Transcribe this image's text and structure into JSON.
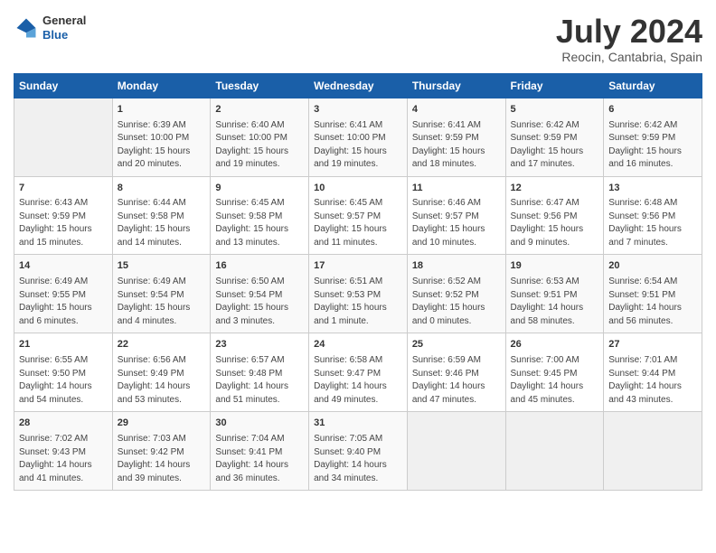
{
  "header": {
    "logo_general": "General",
    "logo_blue": "Blue",
    "month_title": "July 2024",
    "location": "Reocin, Cantabria, Spain"
  },
  "weekdays": [
    "Sunday",
    "Monday",
    "Tuesday",
    "Wednesday",
    "Thursday",
    "Friday",
    "Saturday"
  ],
  "weeks": [
    [
      {
        "day": "",
        "content": ""
      },
      {
        "day": "1",
        "content": "Sunrise: 6:39 AM\nSunset: 10:00 PM\nDaylight: 15 hours\nand 20 minutes."
      },
      {
        "day": "2",
        "content": "Sunrise: 6:40 AM\nSunset: 10:00 PM\nDaylight: 15 hours\nand 19 minutes."
      },
      {
        "day": "3",
        "content": "Sunrise: 6:41 AM\nSunset: 10:00 PM\nDaylight: 15 hours\nand 19 minutes."
      },
      {
        "day": "4",
        "content": "Sunrise: 6:41 AM\nSunset: 9:59 PM\nDaylight: 15 hours\nand 18 minutes."
      },
      {
        "day": "5",
        "content": "Sunrise: 6:42 AM\nSunset: 9:59 PM\nDaylight: 15 hours\nand 17 minutes."
      },
      {
        "day": "6",
        "content": "Sunrise: 6:42 AM\nSunset: 9:59 PM\nDaylight: 15 hours\nand 16 minutes."
      }
    ],
    [
      {
        "day": "7",
        "content": "Sunrise: 6:43 AM\nSunset: 9:59 PM\nDaylight: 15 hours\nand 15 minutes."
      },
      {
        "day": "8",
        "content": "Sunrise: 6:44 AM\nSunset: 9:58 PM\nDaylight: 15 hours\nand 14 minutes."
      },
      {
        "day": "9",
        "content": "Sunrise: 6:45 AM\nSunset: 9:58 PM\nDaylight: 15 hours\nand 13 minutes."
      },
      {
        "day": "10",
        "content": "Sunrise: 6:45 AM\nSunset: 9:57 PM\nDaylight: 15 hours\nand 11 minutes."
      },
      {
        "day": "11",
        "content": "Sunrise: 6:46 AM\nSunset: 9:57 PM\nDaylight: 15 hours\nand 10 minutes."
      },
      {
        "day": "12",
        "content": "Sunrise: 6:47 AM\nSunset: 9:56 PM\nDaylight: 15 hours\nand 9 minutes."
      },
      {
        "day": "13",
        "content": "Sunrise: 6:48 AM\nSunset: 9:56 PM\nDaylight: 15 hours\nand 7 minutes."
      }
    ],
    [
      {
        "day": "14",
        "content": "Sunrise: 6:49 AM\nSunset: 9:55 PM\nDaylight: 15 hours\nand 6 minutes."
      },
      {
        "day": "15",
        "content": "Sunrise: 6:49 AM\nSunset: 9:54 PM\nDaylight: 15 hours\nand 4 minutes."
      },
      {
        "day": "16",
        "content": "Sunrise: 6:50 AM\nSunset: 9:54 PM\nDaylight: 15 hours\nand 3 minutes."
      },
      {
        "day": "17",
        "content": "Sunrise: 6:51 AM\nSunset: 9:53 PM\nDaylight: 15 hours\nand 1 minute."
      },
      {
        "day": "18",
        "content": "Sunrise: 6:52 AM\nSunset: 9:52 PM\nDaylight: 15 hours\nand 0 minutes."
      },
      {
        "day": "19",
        "content": "Sunrise: 6:53 AM\nSunset: 9:51 PM\nDaylight: 14 hours\nand 58 minutes."
      },
      {
        "day": "20",
        "content": "Sunrise: 6:54 AM\nSunset: 9:51 PM\nDaylight: 14 hours\nand 56 minutes."
      }
    ],
    [
      {
        "day": "21",
        "content": "Sunrise: 6:55 AM\nSunset: 9:50 PM\nDaylight: 14 hours\nand 54 minutes."
      },
      {
        "day": "22",
        "content": "Sunrise: 6:56 AM\nSunset: 9:49 PM\nDaylight: 14 hours\nand 53 minutes."
      },
      {
        "day": "23",
        "content": "Sunrise: 6:57 AM\nSunset: 9:48 PM\nDaylight: 14 hours\nand 51 minutes."
      },
      {
        "day": "24",
        "content": "Sunrise: 6:58 AM\nSunset: 9:47 PM\nDaylight: 14 hours\nand 49 minutes."
      },
      {
        "day": "25",
        "content": "Sunrise: 6:59 AM\nSunset: 9:46 PM\nDaylight: 14 hours\nand 47 minutes."
      },
      {
        "day": "26",
        "content": "Sunrise: 7:00 AM\nSunset: 9:45 PM\nDaylight: 14 hours\nand 45 minutes."
      },
      {
        "day": "27",
        "content": "Sunrise: 7:01 AM\nSunset: 9:44 PM\nDaylight: 14 hours\nand 43 minutes."
      }
    ],
    [
      {
        "day": "28",
        "content": "Sunrise: 7:02 AM\nSunset: 9:43 PM\nDaylight: 14 hours\nand 41 minutes."
      },
      {
        "day": "29",
        "content": "Sunrise: 7:03 AM\nSunset: 9:42 PM\nDaylight: 14 hours\nand 39 minutes."
      },
      {
        "day": "30",
        "content": "Sunrise: 7:04 AM\nSunset: 9:41 PM\nDaylight: 14 hours\nand 36 minutes."
      },
      {
        "day": "31",
        "content": "Sunrise: 7:05 AM\nSunset: 9:40 PM\nDaylight: 14 hours\nand 34 minutes."
      },
      {
        "day": "",
        "content": ""
      },
      {
        "day": "",
        "content": ""
      },
      {
        "day": "",
        "content": ""
      }
    ]
  ]
}
